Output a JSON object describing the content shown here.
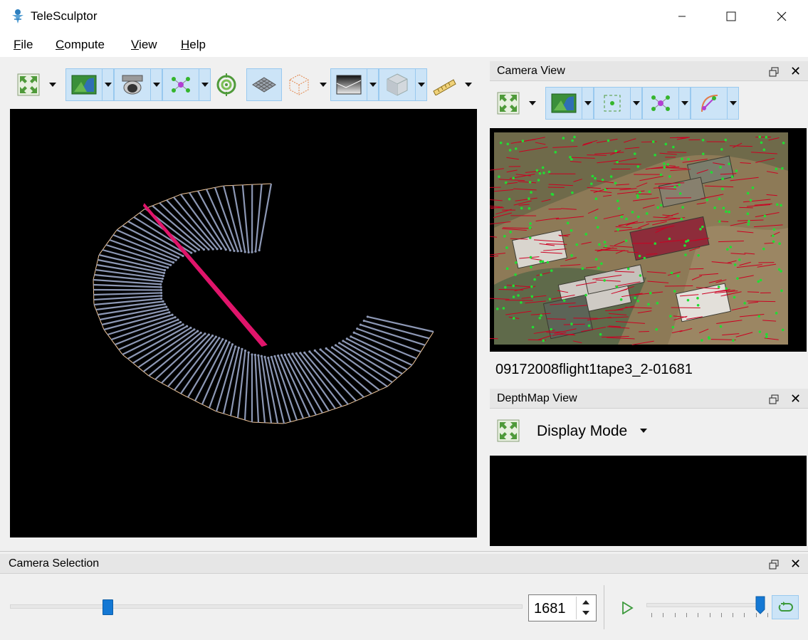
{
  "window": {
    "title": "TeleSculptor",
    "minimize_icon": "minimize-icon",
    "maximize_icon": "maximize-icon",
    "close_icon": "close-icon"
  },
  "menu": [
    {
      "label": "File",
      "accel": "F",
      "rest": "ile"
    },
    {
      "label": "Compute",
      "accel": "C",
      "rest": "ompute"
    },
    {
      "label": "View",
      "accel": "V",
      "rest": "iew"
    },
    {
      "label": "Help",
      "accel": "H",
      "rest": "elp"
    }
  ],
  "world_toolbar": {
    "buttons": [
      "reset-view-icon",
      "image-icon",
      "camera-icon",
      "landmarks-icon",
      "ground-control-icon",
      "ground-plane-icon",
      "roi-box-icon",
      "depth-map-icon",
      "volume-icon",
      "ruler-icon"
    ]
  },
  "camera_view": {
    "title": "Camera View",
    "frame_name": "09172008flight1tape3_2-01681",
    "buttons": [
      "reset-view-icon",
      "image-icon",
      "feature-points-icon",
      "landmarks-icon",
      "residuals-icon"
    ]
  },
  "depthmap_view": {
    "title": "DepthMap View",
    "display_mode_label": "Display Mode"
  },
  "camera_selection": {
    "title": "Camera Selection",
    "frame_value": "1681",
    "slider_position": 0.19,
    "speed_position": 1.0,
    "colors": {
      "accent": "#1478d4",
      "toggled": "#cce4f7"
    }
  },
  "colors": {
    "trajectory": "#f3c89b",
    "camera_frustum": "#8d98b5",
    "selected_camera": "#e0156b",
    "features": "#22dd33",
    "residuals": "#cc0022"
  }
}
